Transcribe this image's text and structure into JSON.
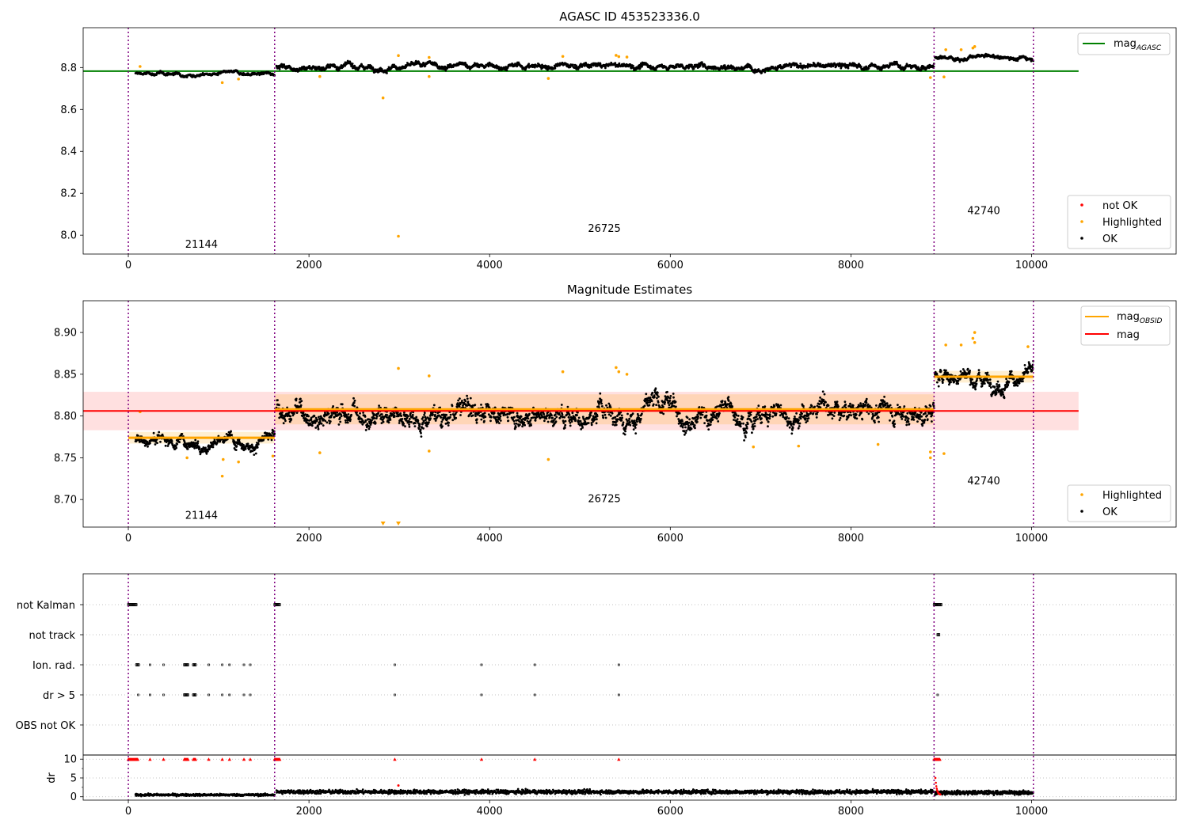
{
  "chart_data": [
    {
      "type": "scatter",
      "title": "AGASC ID 453523336.0",
      "xlim": [
        -500,
        11600
      ],
      "ylim": [
        7.91,
        8.99
      ],
      "yticks": [
        8.0,
        8.2,
        8.4,
        8.6,
        8.8
      ],
      "ytick_labels": [
        "8.0",
        "8.2",
        "8.4",
        "8.6",
        "8.8"
      ],
      "xticks": [
        0,
        2000,
        4000,
        6000,
        8000,
        10000
      ],
      "xtick_labels": [
        "0",
        "2000",
        "4000",
        "6000",
        "8000",
        "10000"
      ],
      "vlines": [
        0,
        1620,
        8920,
        10020
      ],
      "obsid_labels": [
        {
          "text": "21144",
          "x": 810,
          "y": 7.94
        },
        {
          "text": "26725",
          "x": 5270,
          "y": 8.015
        },
        {
          "text": "42740",
          "x": 9470,
          "y": 8.1
        }
      ],
      "hlines": [
        {
          "name": "mag_AGASC",
          "y": 8.783,
          "x": [
            -500,
            10520
          ],
          "color": "#008000"
        }
      ],
      "segments": [
        {
          "x": [
            80,
            1620
          ],
          "level": 8.77,
          "noise": 0.006
        },
        {
          "x": [
            1640,
            8920
          ],
          "level": 8.806,
          "noise": 0.01
        },
        {
          "x": [
            8930,
            10020
          ],
          "level": 8.848,
          "noise": 0.008
        }
      ],
      "highlighted_points": [
        {
          "x": 1040,
          "y": 8.728
        },
        {
          "x": 1220,
          "y": 8.745
        },
        {
          "x": 2120,
          "y": 8.757
        },
        {
          "x": 2820,
          "y": 8.655
        },
        {
          "x": 2990,
          "y": 7.995
        },
        {
          "x": 2990,
          "y": 8.857
        },
        {
          "x": 3330,
          "y": 8.757
        },
        {
          "x": 3330,
          "y": 8.848
        },
        {
          "x": 4650,
          "y": 8.748
        },
        {
          "x": 4810,
          "y": 8.853
        },
        {
          "x": 5400,
          "y": 8.858
        },
        {
          "x": 5430,
          "y": 8.852
        },
        {
          "x": 5520,
          "y": 8.85
        },
        {
          "x": 8880,
          "y": 8.752
        },
        {
          "x": 9030,
          "y": 8.755
        },
        {
          "x": 9370,
          "y": 8.9
        },
        {
          "x": 9350,
          "y": 8.893
        },
        {
          "x": 9220,
          "y": 8.885
        },
        {
          "x": 9050,
          "y": 8.885
        },
        {
          "x": 130,
          "y": 8.805
        }
      ],
      "legend_lines": {
        "position": "upper right",
        "items": [
          {
            "label": "mag",
            "sub": "AGASC",
            "color": "#008000"
          }
        ]
      },
      "legend_points": {
        "position": "lower right",
        "items": [
          {
            "label": "not OK",
            "color": "#ff0000"
          },
          {
            "label": "Highlighted",
            "color": "#ffa500"
          },
          {
            "label": "OK",
            "color": "#000000"
          }
        ]
      }
    },
    {
      "type": "scatter",
      "title": "Magnitude Estimates",
      "xlim": [
        -500,
        11600
      ],
      "ylim": [
        8.667,
        8.938
      ],
      "yticks": [
        8.7,
        8.75,
        8.8,
        8.85,
        8.9
      ],
      "ytick_labels": [
        "8.70",
        "8.75",
        "8.80",
        "8.85",
        "8.90"
      ],
      "xticks": [
        0,
        2000,
        4000,
        6000,
        8000,
        10000
      ],
      "xtick_labels": [
        "0",
        "2000",
        "4000",
        "6000",
        "8000",
        "10000"
      ],
      "vlines": [
        0,
        1620,
        8920,
        10020
      ],
      "obsid_labels": [
        {
          "text": "21144",
          "x": 810,
          "y": 8.677
        },
        {
          "text": "26725",
          "x": 5270,
          "y": 8.697
        },
        {
          "text": "42740",
          "x": 9470,
          "y": 8.718
        }
      ],
      "mag": {
        "value": 8.806,
        "band": [
          8.783,
          8.829
        ],
        "x": [
          -500,
          10520
        ],
        "color": "#ff0000"
      },
      "obsid_mags": [
        {
          "x": [
            0,
            1620
          ],
          "value": 8.774,
          "band": [
            8.767,
            8.781
          ]
        },
        {
          "x": [
            1620,
            8920
          ],
          "value": 8.808,
          "band": [
            8.79,
            8.826
          ]
        },
        {
          "x": [
            8920,
            10020
          ],
          "value": 8.847,
          "band": [
            8.84,
            8.854
          ]
        }
      ],
      "segments": [
        {
          "x": [
            80,
            1620
          ],
          "level": 8.772,
          "noise": 0.006
        },
        {
          "x": [
            1640,
            8920
          ],
          "level": 8.806,
          "noise": 0.01
        },
        {
          "x": [
            8930,
            10020
          ],
          "level": 8.848,
          "noise": 0.008
        }
      ],
      "highlighted_points": [
        {
          "x": 130,
          "y": 8.805
        },
        {
          "x": 650,
          "y": 8.75
        },
        {
          "x": 1040,
          "y": 8.728
        },
        {
          "x": 1050,
          "y": 8.748
        },
        {
          "x": 1220,
          "y": 8.745
        },
        {
          "x": 1600,
          "y": 8.752
        },
        {
          "x": 2120,
          "y": 8.756
        },
        {
          "x": 2990,
          "y": 8.857
        },
        {
          "x": 3330,
          "y": 8.848
        },
        {
          "x": 3330,
          "y": 8.758
        },
        {
          "x": 4650,
          "y": 8.748
        },
        {
          "x": 4810,
          "y": 8.853
        },
        {
          "x": 5400,
          "y": 8.858
        },
        {
          "x": 5430,
          "y": 8.853
        },
        {
          "x": 5520,
          "y": 8.85
        },
        {
          "x": 6920,
          "y": 8.763
        },
        {
          "x": 7420,
          "y": 8.764
        },
        {
          "x": 8300,
          "y": 8.766
        },
        {
          "x": 8880,
          "y": 8.75
        },
        {
          "x": 8880,
          "y": 8.757
        },
        {
          "x": 9030,
          "y": 8.755
        },
        {
          "x": 9050,
          "y": 8.885
        },
        {
          "x": 9220,
          "y": 8.885
        },
        {
          "x": 9370,
          "y": 8.9
        },
        {
          "x": 9350,
          "y": 8.893
        },
        {
          "x": 9370,
          "y": 8.888
        },
        {
          "x": 9960,
          "y": 8.883
        }
      ],
      "offscale_points": [
        {
          "x": 2820
        },
        {
          "x": 2990
        }
      ],
      "legend_lines": {
        "position": "upper right",
        "items": [
          {
            "label": "mag",
            "sub": "OBSID",
            "color": "#ffa500"
          },
          {
            "label": "mag",
            "sub": "",
            "color": "#ff0000"
          }
        ]
      },
      "legend_points": {
        "position": "lower right",
        "items": [
          {
            "label": "Highlighted",
            "color": "#ffa500"
          },
          {
            "label": "OK",
            "color": "#000000"
          }
        ]
      }
    },
    {
      "type": "scatter",
      "title": "",
      "xlim": [
        -500,
        11600
      ],
      "flag_labels": [
        "not Kalman",
        "not track",
        "Ion. rad.",
        "dr > 5",
        "OBS not OK"
      ],
      "dr_ylabel": "dr",
      "dr_ylim": [
        -0.9,
        11.1
      ],
      "dr_yticks": [
        0,
        5,
        10
      ],
      "dr_ytick_labels": [
        "0",
        "5",
        "10"
      ],
      "xticks": [
        0,
        2000,
        4000,
        6000,
        8000,
        10000
      ],
      "xtick_labels": [
        "0",
        "2000",
        "4000",
        "6000",
        "8000",
        "10000"
      ],
      "vlines": [
        0,
        1620,
        8920,
        10020
      ],
      "flag_points": {
        "not Kalman": [
          [
            0,
            90
          ],
          [
            1620,
            1680
          ],
          [
            8920,
            9000
          ]
        ],
        "not track": [
          [
            8960,
            8980
          ]
        ],
        "Ion. rad.": [
          [
            90,
            120
          ],
          [
            240
          ],
          [
            390
          ],
          [
            620,
            660
          ],
          [
            720,
            750
          ],
          [
            890
          ],
          [
            1040
          ],
          [
            1120
          ],
          [
            1280
          ],
          [
            1350
          ],
          [
            2950
          ],
          [
            3910
          ],
          [
            4500
          ],
          [
            5430
          ]
        ],
        "dr > 5": [
          [
            110
          ],
          [
            240
          ],
          [
            390
          ],
          [
            620,
            660
          ],
          [
            720,
            750
          ],
          [
            890
          ],
          [
            1040
          ],
          [
            1120
          ],
          [
            1280
          ],
          [
            1350
          ],
          [
            2950
          ],
          [
            3910
          ],
          [
            4500
          ],
          [
            5430
          ],
          [
            8960
          ]
        ]
      },
      "dr_segments": [
        {
          "x": [
            80,
            1620
          ],
          "level": 0.5,
          "noise": 0.25
        },
        {
          "x": [
            1640,
            8920
          ],
          "level": 1.3,
          "noise": 0.45
        },
        {
          "x": [
            8930,
            10020
          ],
          "level": 1.1,
          "noise": 0.45
        }
      ],
      "dr_capped": [
        [
          0,
          110
        ],
        [
          240
        ],
        [
          390
        ],
        [
          620,
          660
        ],
        [
          720,
          750
        ],
        [
          890
        ],
        [
          1040
        ],
        [
          1120
        ],
        [
          1280
        ],
        [
          1350
        ],
        [
          1620,
          1680
        ],
        [
          2950
        ],
        [
          3910
        ],
        [
          4500
        ],
        [
          5430
        ],
        [
          8920,
          8990
        ]
      ]
    }
  ]
}
